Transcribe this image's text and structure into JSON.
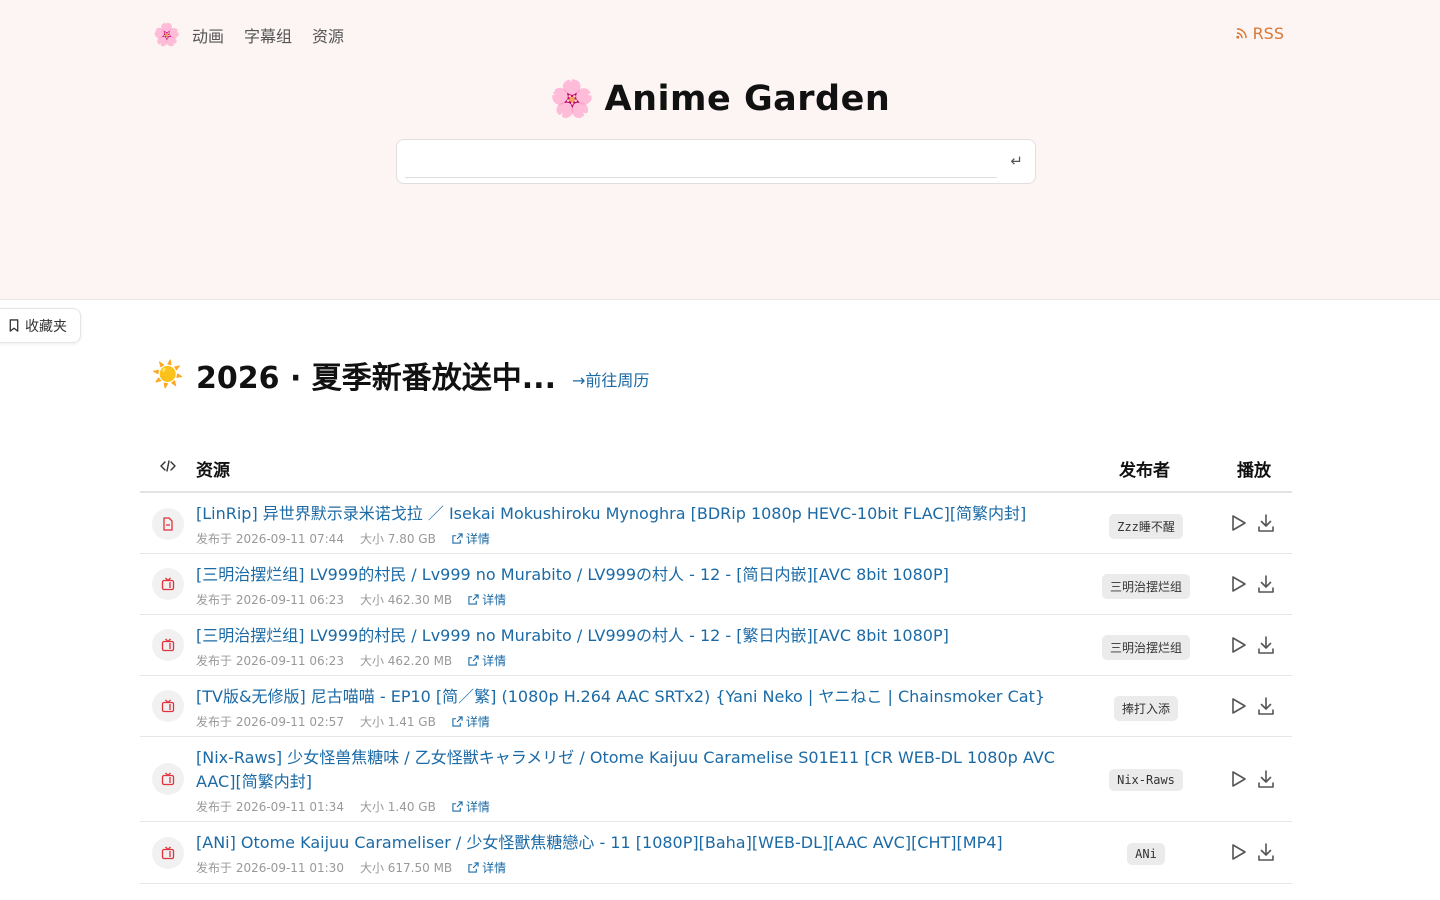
{
  "nav": {
    "logo": "🌸",
    "links": [
      "动画",
      "字幕组",
      "资源"
    ],
    "rss_label": "RSS"
  },
  "brand": {
    "logo": "🌸",
    "title": "Anime Garden"
  },
  "search": {
    "value": "",
    "placeholder": "",
    "enter_symbol": "↵"
  },
  "favorites_label": "收藏夹",
  "season": {
    "icon": "☀️",
    "title": "2026 · 夏季新番放送中...",
    "calendar_link": "→前往周历"
  },
  "table": {
    "headers": {
      "resource": "资源",
      "publisher": "发布者",
      "play": "播放"
    },
    "rows": [
      {
        "type_icon": "file-icon",
        "title": "[LinRip] 异世界默示录米诺戈拉 ／ Isekai Mokushiroku Mynoghra [BDRip 1080p HEVC-10bit FLAC][简繁内封]",
        "published": "发布于 2026-09-11 07:44",
        "size": "大小 7.80 GB",
        "detail": "详情",
        "publisher": "Zzz睡不醒"
      },
      {
        "type_icon": "tv-icon",
        "title": "[三明治摆烂组] LV999的村民 / Lv999 no Murabito / LV999の村人 - 12 - [简日内嵌][AVC 8bit 1080P]",
        "published": "发布于 2026-09-11 06:23",
        "size": "大小 462.30 MB",
        "detail": "详情",
        "publisher": "三明治摆烂组"
      },
      {
        "type_icon": "tv-icon",
        "title": "[三明治摆烂组] LV999的村民 / Lv999 no Murabito / LV999の村人 - 12 - [繁日内嵌][AVC 8bit 1080P]",
        "published": "发布于 2026-09-11 06:23",
        "size": "大小 462.20 MB",
        "detail": "详情",
        "publisher": "三明治摆烂组"
      },
      {
        "type_icon": "tv-icon",
        "title": "[TV版&无修版] 尼古喵喵 - EP10 [简／繁] (1080p H.264 AAC SRTx2) {Yani Neko | ヤニねこ | Chainsmoker Cat}",
        "published": "发布于 2026-09-11 02:57",
        "size": "大小 1.41 GB",
        "detail": "详情",
        "publisher": "捧打入添"
      },
      {
        "type_icon": "tv-icon",
        "title": "[Nix-Raws] 少女怪兽焦糖味 / 乙女怪獣キャラメリゼ / Otome Kaijuu Caramelise S01E11 [CR WEB-DL 1080p AVC AAC][简繁内封]",
        "published": "发布于 2026-09-11 01:34",
        "size": "大小 1.40 GB",
        "detail": "详情",
        "publisher": "Nix-Raws"
      },
      {
        "type_icon": "tv-icon",
        "title": "[ANi] Otome Kaijuu Carameliser / 少女怪獸焦糖戀心 - 11 [1080P][Baha][WEB-DL][AAC AVC][CHT][MP4]",
        "published": "发布于 2026-09-11 01:30",
        "size": "大小 617.50 MB",
        "detail": "详情",
        "publisher": "ANi"
      }
    ]
  },
  "colors": {
    "hero_bg": "#fdf4f4",
    "link": "#1b6aa5",
    "rss": "#d97732",
    "type_icon": "#e0323c"
  }
}
